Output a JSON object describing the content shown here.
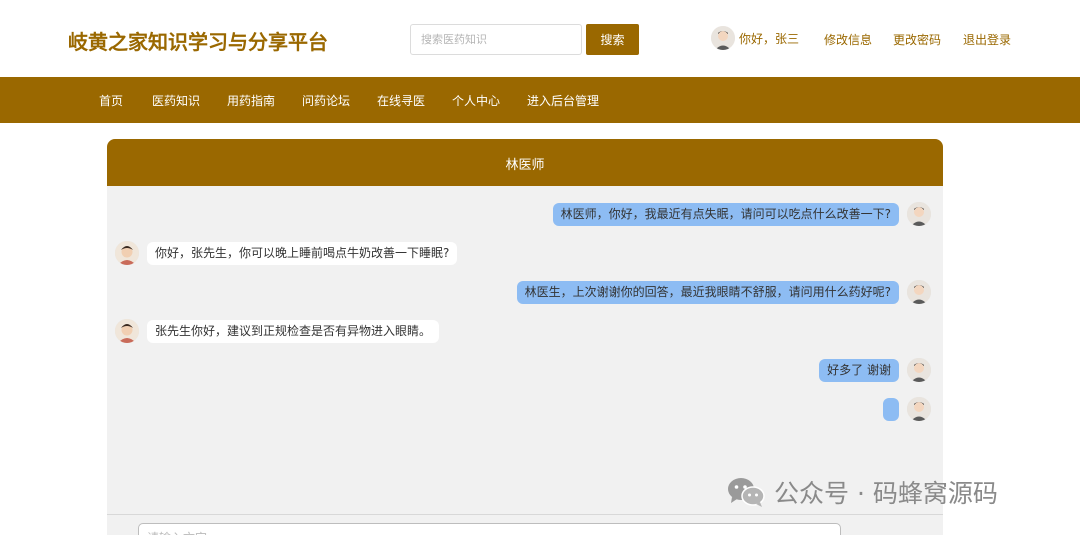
{
  "header": {
    "site_title": "岐黄之家知识学习与分享平台",
    "search_placeholder": "搜索医药知识",
    "search_button": "搜索",
    "greeting": "你好，张三",
    "edit_info": "修改信息",
    "change_password": "更改密码",
    "logout": "退出登录"
  },
  "nav": {
    "items": [
      {
        "label": "首页"
      },
      {
        "label": "医药知识"
      },
      {
        "label": "用药指南"
      },
      {
        "label": "问药论坛"
      },
      {
        "label": "在线寻医"
      },
      {
        "label": "个人中心"
      },
      {
        "label": "进入后台管理"
      }
    ]
  },
  "chat": {
    "title": "林医师",
    "messages": [
      {
        "side": "right",
        "text": "林医师，你好，我最近有点失眠，请问可以吃点什么改善一下?"
      },
      {
        "side": "left",
        "text": "你好，张先生，你可以晚上睡前喝点牛奶改善一下睡眠?"
      },
      {
        "side": "right",
        "text": "林医生，上次谢谢你的回答，最近我眼睛不舒服，请问用什么药好呢?"
      },
      {
        "side": "left",
        "text": "张先生你好，建议到正规检查是否有异物进入眼睛。"
      },
      {
        "side": "right",
        "text": "好多了 谢谢"
      },
      {
        "side": "right",
        "text": ""
      }
    ],
    "input_placeholder": "请输入文字"
  },
  "watermark": {
    "text": "公众号 · 码蜂窝源码"
  },
  "colors": {
    "brand": "#9a6800",
    "bubble_right": "#8dbcf3",
    "chat_bg": "#f1f1f1"
  }
}
